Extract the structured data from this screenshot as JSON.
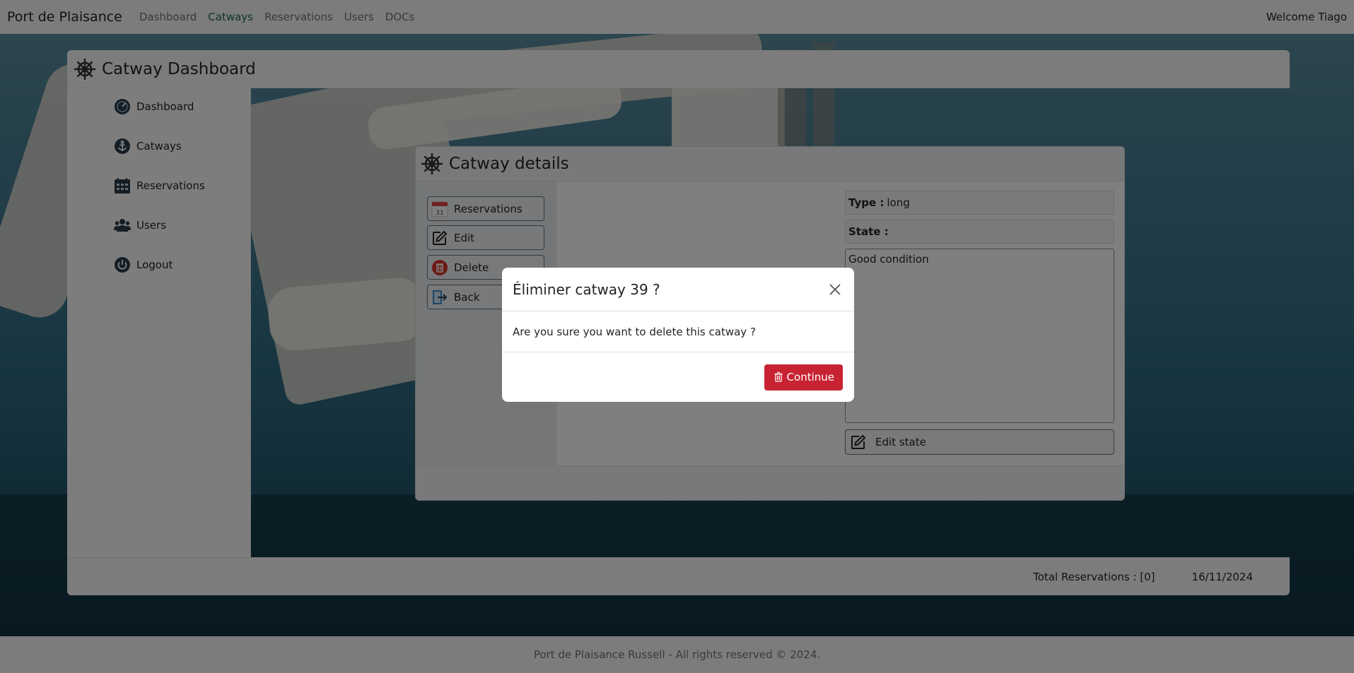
{
  "navbar": {
    "brand": "Port de Plaisance",
    "links": [
      "Dashboard",
      "Catways",
      "Reservations",
      "Users",
      "DOCs"
    ],
    "active_link": "Catways",
    "welcome": "Welcome Tiago"
  },
  "dashboard": {
    "title": "Catway Dashboard",
    "sidebar": [
      {
        "label": "Dashboard",
        "icon": "dashboard-gauge-icon"
      },
      {
        "label": "Catways",
        "icon": "anchor-icon"
      },
      {
        "label": "Reservations",
        "icon": "calendar-grid-icon"
      },
      {
        "label": "Users",
        "icon": "users-icon"
      },
      {
        "label": "Logout",
        "icon": "power-icon"
      }
    ],
    "footer": {
      "total_reservations": "Total Reservations : [0]",
      "date": "16/11/2024"
    }
  },
  "details": {
    "title": "Catway details",
    "buttons": [
      {
        "label": "Reservations",
        "icon": "calendar-icon"
      },
      {
        "label": "Edit",
        "icon": "pencil-square-icon"
      },
      {
        "label": "Delete",
        "icon": "trash-icon"
      },
      {
        "label": "Back",
        "icon": "exit-icon"
      }
    ],
    "type_label": "Type :",
    "type_value": "long",
    "state_label": "State :",
    "state_text": "Good condition",
    "edit_state_label": "Edit state"
  },
  "modal": {
    "title": "Éliminer catway 39 ?",
    "body": "Are you sure you want to delete this catway ?",
    "continue_label": "Continue"
  },
  "page_footer": "Port de Plaisance Russell - All rights reserved © 2024.",
  "colors": {
    "navbar_bg": "#f8f9fa",
    "active_link": "#1d6b4c",
    "danger": "#c82333",
    "water": "#2b6d86"
  }
}
